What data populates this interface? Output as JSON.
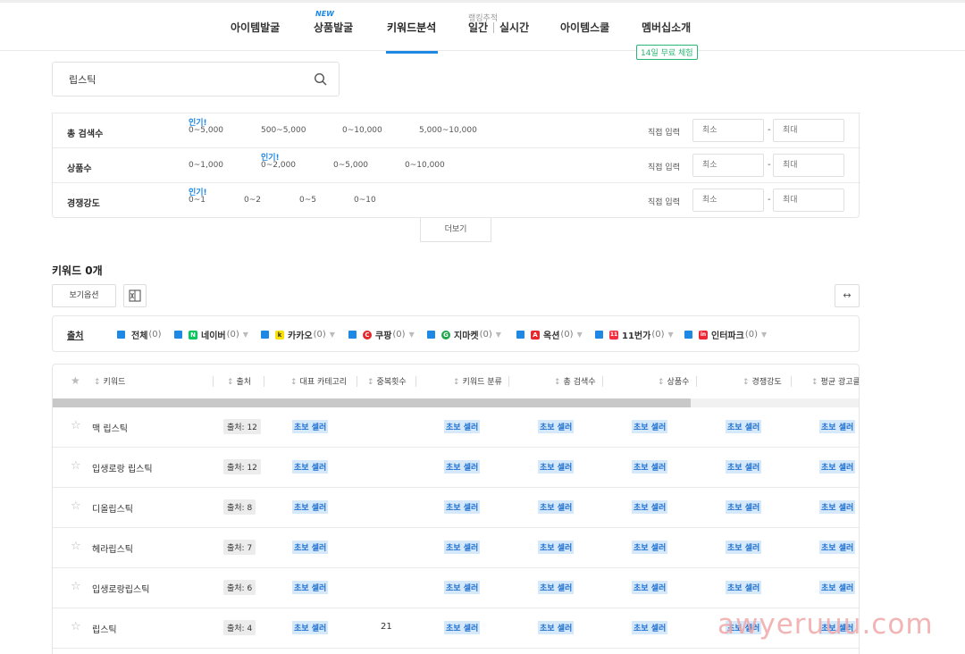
{
  "nav": {
    "items": [
      {
        "label": "아이템발굴"
      },
      {
        "label": "상품발굴",
        "badge": "NEW"
      },
      {
        "label": "키워드분석",
        "active": true
      },
      {
        "label": "일간"
      },
      {
        "label": "실시간"
      },
      {
        "label": "아이템스쿨"
      },
      {
        "label": "멤버십소개"
      }
    ],
    "ranking_label": "랭킹추적",
    "trial_badge": "14일 무료 체험"
  },
  "search": {
    "value": "립스틱",
    "icon": "search-icon"
  },
  "filters": {
    "direct_label": "직접 입력",
    "min_placeholder": "최소",
    "max_placeholder": "최대",
    "dash": "-",
    "popular_tag": "인기!",
    "rows": [
      {
        "label": "총 검색수",
        "options": [
          "0~5,000",
          "500~5,000",
          "0~10,000",
          "5,000~10,000"
        ],
        "popular_index": 0
      },
      {
        "label": "상품수",
        "options": [
          "0~1,000",
          "0~2,000",
          "0~5,000",
          "0~10,000"
        ],
        "popular_index": 1
      },
      {
        "label": "경쟁강도",
        "options": [
          "0~1",
          "0~2",
          "0~5",
          "0~10"
        ],
        "popular_index": 0
      }
    ],
    "more_label": "더보기"
  },
  "keywords": {
    "count_label": "키워드 0개",
    "view_option_label": "보기옵션",
    "expand_symbol": "↔"
  },
  "sources": {
    "title": "출처",
    "items": [
      {
        "name": "전체",
        "count": "(0)",
        "logo_color": "",
        "logo_text": ""
      },
      {
        "name": "네이버",
        "count": "(0)",
        "logo_color": "#03c75a",
        "logo_text": "N"
      },
      {
        "name": "카카오",
        "count": "(0)",
        "logo_color": "#fae100",
        "logo_text": "k"
      },
      {
        "name": "쿠팡",
        "count": "(0)",
        "logo_color": "#e52528",
        "logo_text": "C"
      },
      {
        "name": "지마켓",
        "count": "(0)",
        "logo_color": "#1fa64a",
        "logo_text": "G"
      },
      {
        "name": "옥션",
        "count": "(0)",
        "logo_color": "#e8262d",
        "logo_text": "A"
      },
      {
        "name": "11번가",
        "count": "(0)",
        "logo_color": "#f43142",
        "logo_text": "11"
      },
      {
        "name": "인터파크",
        "count": "(0)",
        "logo_color": "#ee2737",
        "logo_text": "in"
      }
    ]
  },
  "table": {
    "columns": [
      "키워드",
      "출처",
      "대표 카테고리",
      "중복횟수",
      "키워드 분류",
      "총 검색수",
      "상품수",
      "경쟁강도",
      "평균 광고클"
    ],
    "chip_label": "초보 셀러",
    "scroll_fraction": 0.79,
    "rows": [
      {
        "keyword": "맥 립스틱",
        "source": "출처: 12",
        "dup": ""
      },
      {
        "keyword": "입생로랑 립스틱",
        "source": "출처: 12",
        "dup": ""
      },
      {
        "keyword": "디올립스틱",
        "source": "출처: 8",
        "dup": ""
      },
      {
        "keyword": "헤라립스틱",
        "source": "출처: 7",
        "dup": ""
      },
      {
        "keyword": "입생로랑립스틱",
        "source": "출처: 6",
        "dup": ""
      },
      {
        "keyword": "립스틱",
        "source": "출처: 4",
        "dup": "21"
      }
    ]
  },
  "watermark": "awyeruuu.com",
  "colors": {
    "accent": "#1e88e5",
    "trial": "#2bb673",
    "chip_bg": "#d6e9fb"
  }
}
